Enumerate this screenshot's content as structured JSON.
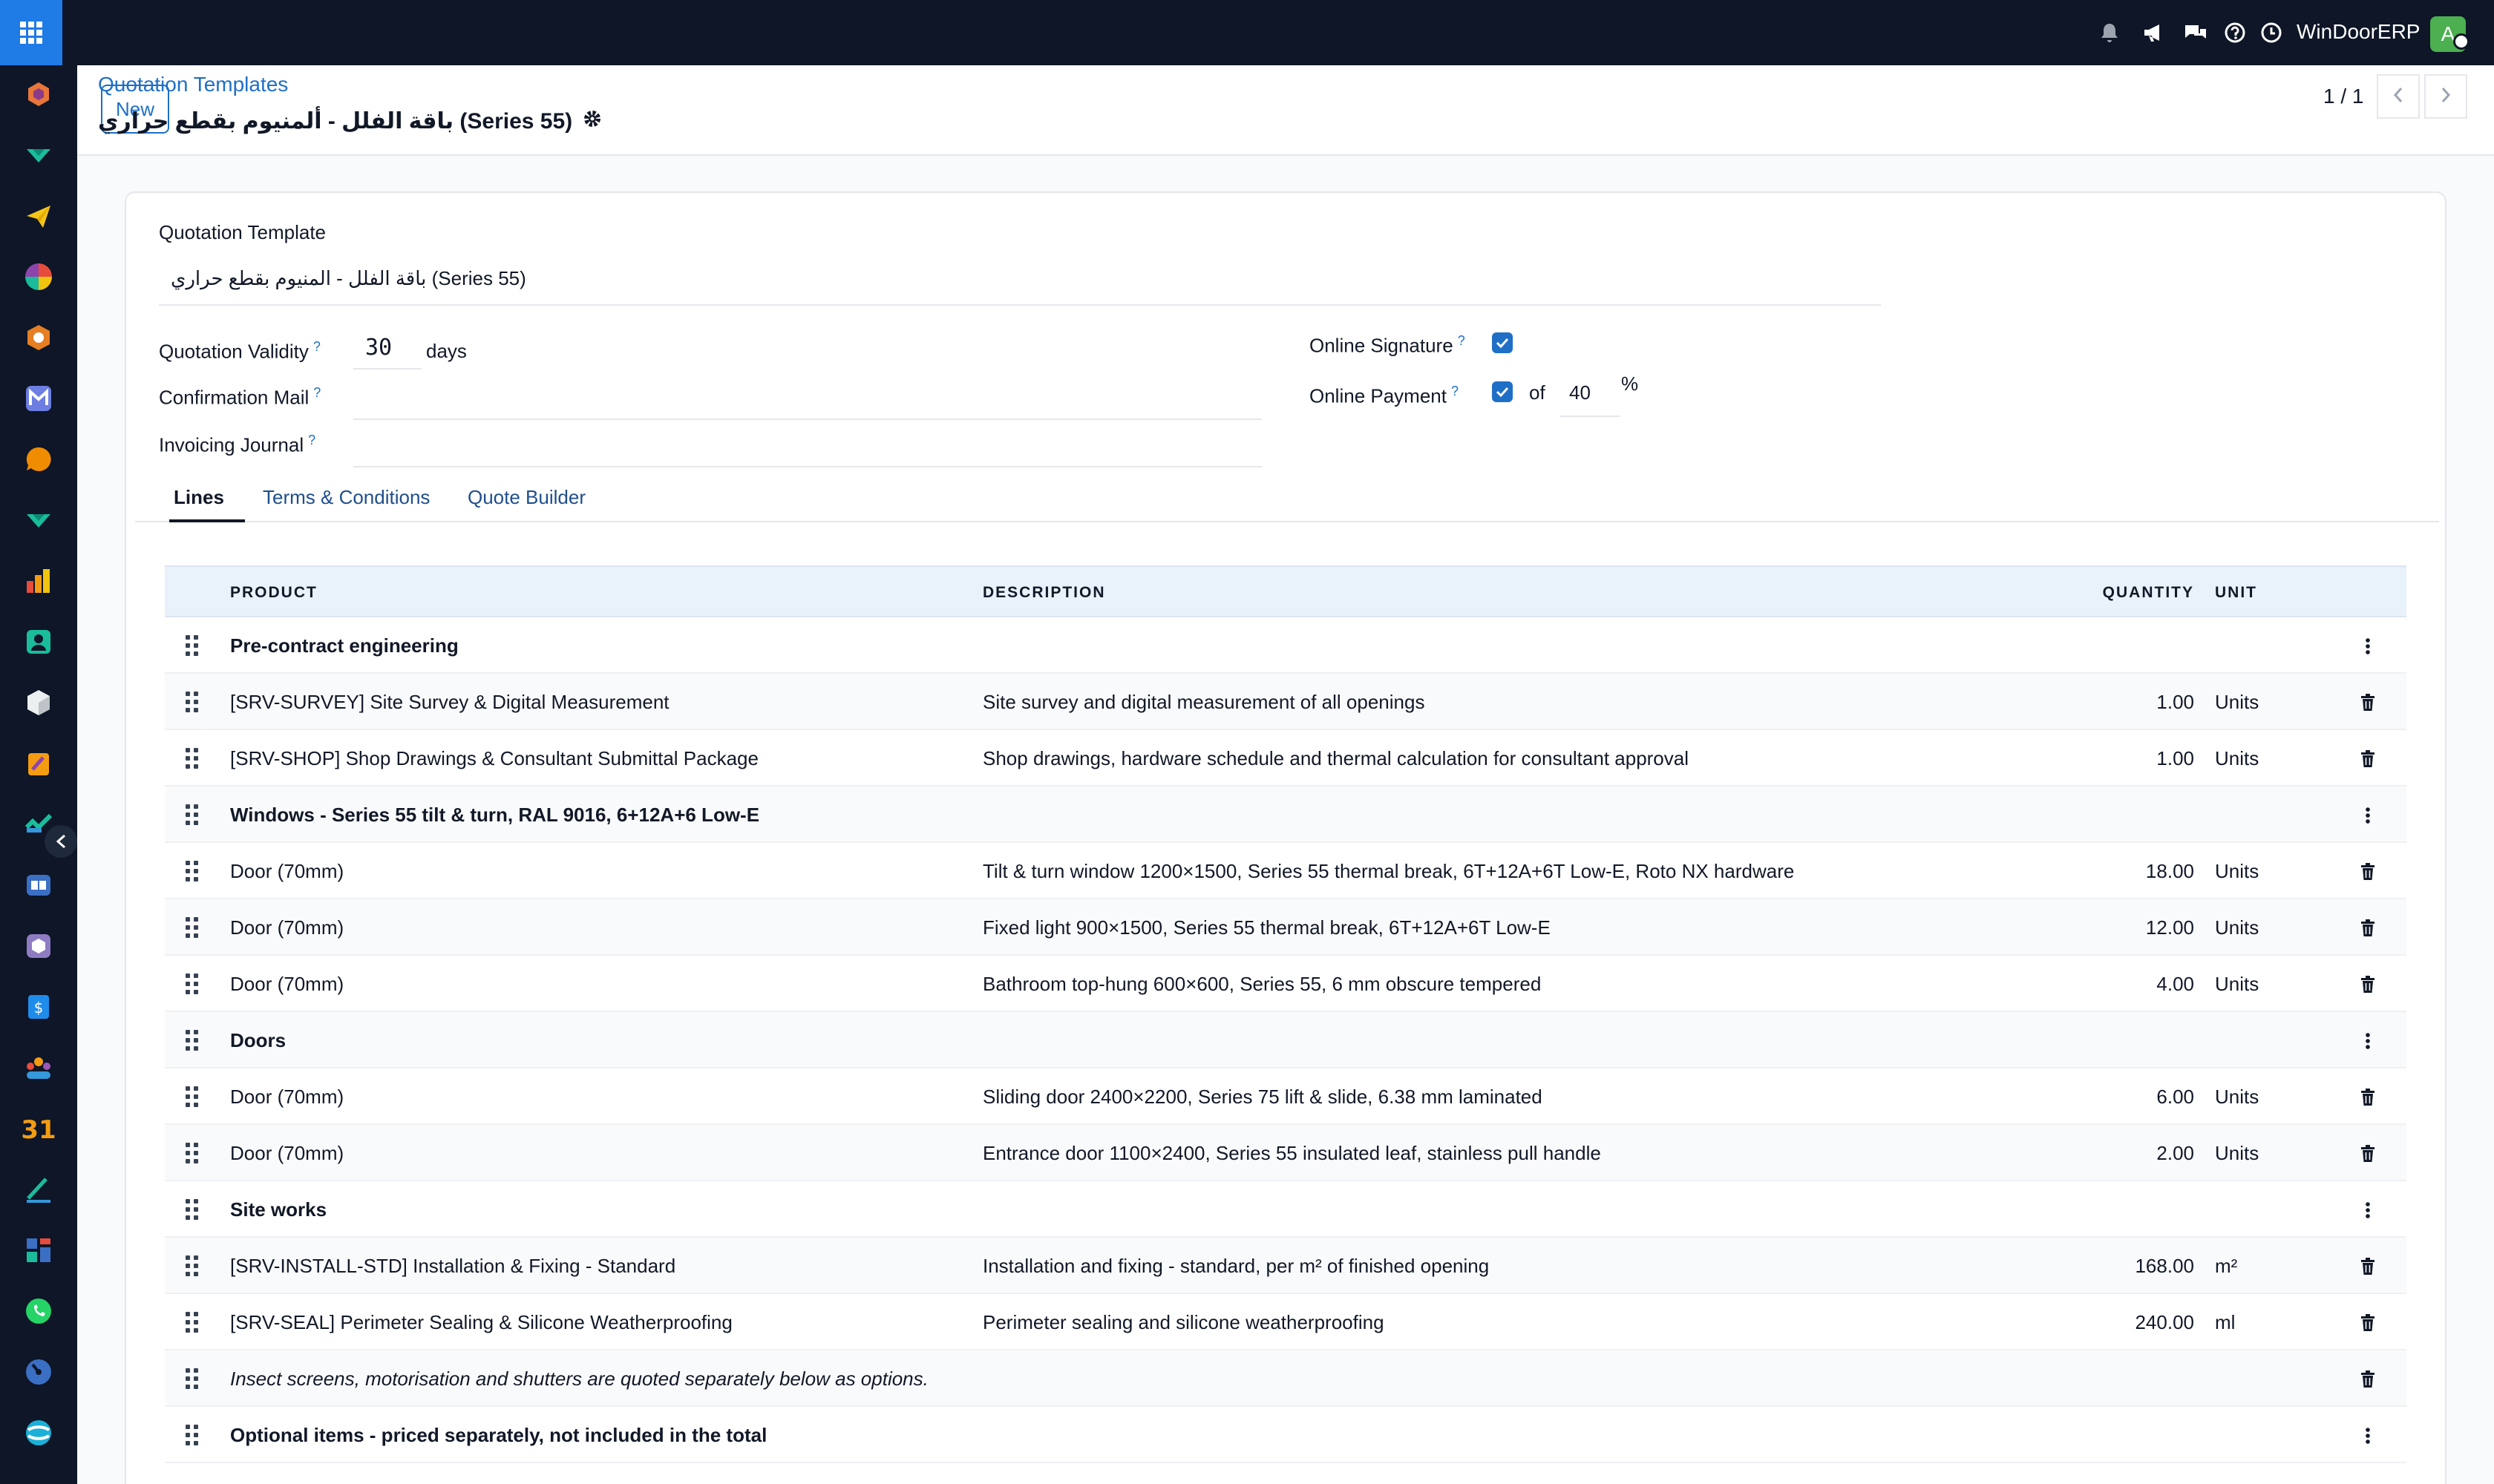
{
  "topbar": {
    "company_name": "WinDoorERP",
    "avatar_letter": "A",
    "icons": [
      "bell-icon",
      "megaphone-icon",
      "chat-icon",
      "help-icon",
      "clock-icon"
    ]
  },
  "sidebar": {
    "apps": [
      "crm-icon",
      "helpdesk-icon",
      "email-marketing-icon",
      "dashboard-icon",
      "project-icon",
      "marketing-icon",
      "discuss-icon",
      "helpdesk-2-icon",
      "reporting-icon",
      "contacts-icon",
      "inventory-icon",
      "documents-icon",
      "planning-icon",
      "knowledge-icon",
      "manufacturing-icon",
      "invoicing-icon",
      "employees-icon",
      "calendar-icon",
      "sign-icon",
      "dashboards-icon",
      "whatsapp-icon",
      "timer-icon",
      "website-icon"
    ]
  },
  "control_panel": {
    "new_label": "New",
    "breadcrumb": "Quotation Templates",
    "record_title": "باقة الفلل - ألمنيوم بقطع حراري (Series 55)",
    "pager": "1 / 1"
  },
  "form": {
    "template_label": "Quotation Template",
    "template_value": "باقة الفلل - المنيوم بقطع حراري (Series 55)",
    "validity_label": "Quotation Validity",
    "validity_value": "30",
    "validity_suffix": "days",
    "confirmation_mail_label": "Confirmation Mail",
    "confirmation_mail_value": "",
    "journal_label": "Invoicing Journal",
    "journal_value": "",
    "signature_label": "Online Signature",
    "signature_checked": true,
    "payment_label": "Online Payment",
    "payment_checked": true,
    "payment_of": "of",
    "payment_percent": "40",
    "payment_percent_sign": "%",
    "help_mark": "?"
  },
  "tabs": [
    {
      "label": "Lines",
      "active": true
    },
    {
      "label": "Terms & Conditions",
      "active": false
    },
    {
      "label": "Quote Builder",
      "active": false
    }
  ],
  "table": {
    "headers": {
      "product": "PRODUCT",
      "description": "DESCRIPTION",
      "quantity": "QUANTITY",
      "unit": "UNIT"
    },
    "rows": [
      {
        "type": "section",
        "product": "Pre-contract engineering",
        "description": "",
        "quantity": "",
        "unit": ""
      },
      {
        "type": "line",
        "product": "[SRV-SURVEY] Site Survey & Digital Measurement",
        "description": "Site survey and digital measurement of all openings",
        "quantity": "1.00",
        "unit": "Units"
      },
      {
        "type": "line",
        "product": "[SRV-SHOP] Shop Drawings & Consultant Submittal Package",
        "description": "Shop drawings, hardware schedule and thermal calculation for consultant approval",
        "quantity": "1.00",
        "unit": "Units"
      },
      {
        "type": "section",
        "product": "Windows - Series 55 tilt & turn, RAL 9016, 6+12A+6 Low-E",
        "description": "",
        "quantity": "",
        "unit": ""
      },
      {
        "type": "line",
        "product": "Door (70mm)",
        "description": "Tilt & turn window 1200×1500, Series 55 thermal break, 6T+12A+6T Low-E, Roto NX hardware",
        "quantity": "18.00",
        "unit": "Units"
      },
      {
        "type": "line",
        "product": "Door (70mm)",
        "description": "Fixed light 900×1500, Series 55 thermal break, 6T+12A+6T Low-E",
        "quantity": "12.00",
        "unit": "Units"
      },
      {
        "type": "line",
        "product": "Door (70mm)",
        "description": "Bathroom top-hung 600×600, Series 55, 6 mm obscure tempered",
        "quantity": "4.00",
        "unit": "Units"
      },
      {
        "type": "section",
        "product": "Doors",
        "description": "",
        "quantity": "",
        "unit": ""
      },
      {
        "type": "line",
        "product": "Door (70mm)",
        "description": "Sliding door 2400×2200, Series 75 lift & slide, 6.38 mm laminated",
        "quantity": "6.00",
        "unit": "Units"
      },
      {
        "type": "line",
        "product": "Door (70mm)",
        "description": "Entrance door 1100×2400, Series 55 insulated leaf, stainless pull handle",
        "quantity": "2.00",
        "unit": "Units"
      },
      {
        "type": "section",
        "product": "Site works",
        "description": "",
        "quantity": "",
        "unit": ""
      },
      {
        "type": "line",
        "product": "[SRV-INSTALL-STD] Installation & Fixing - Standard",
        "description": "Installation and fixing - standard, per m² of finished opening",
        "quantity": "168.00",
        "unit": "m²"
      },
      {
        "type": "line",
        "product": "[SRV-SEAL] Perimeter Sealing & Silicone Weatherproofing",
        "description": "Perimeter sealing and silicone weatherproofing",
        "quantity": "240.00",
        "unit": "ml"
      },
      {
        "type": "note",
        "product": "Insect screens, motorisation and shutters are quoted separately below as options.",
        "description": "",
        "quantity": "",
        "unit": ""
      },
      {
        "type": "section",
        "product": "Optional items - priced separately, not included in the total",
        "description": "",
        "quantity": "",
        "unit": ""
      }
    ]
  },
  "colors": {
    "topbar_bg": "#0e1627",
    "accent": "#1f6fc6",
    "apps_button": "#1f7be6",
    "avatar": "#4caf50",
    "table_header": "#e9f1fb"
  }
}
